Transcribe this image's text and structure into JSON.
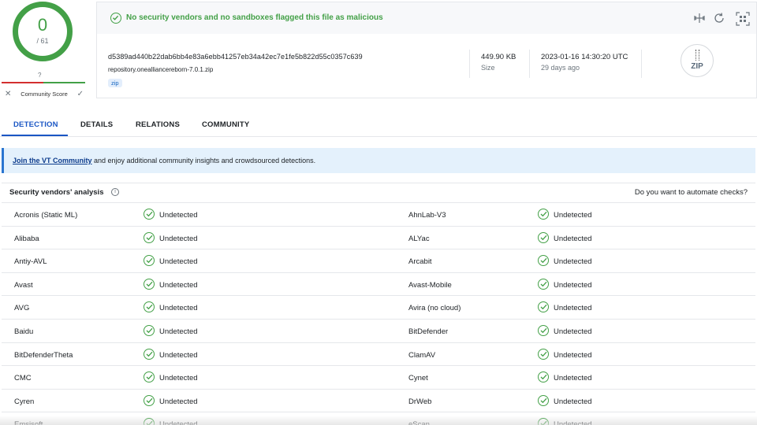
{
  "score": {
    "detections": "0",
    "total": "/ 61",
    "community_unknown": "?",
    "community_label": "Community Score"
  },
  "verdict": {
    "text": "No security vendors and no sandboxes flagged this file as malicious"
  },
  "toolbar": {
    "icons": [
      "compare-icon",
      "reanalyze-icon",
      "similar-icon"
    ]
  },
  "file": {
    "hash": "d5389ad440b22dab6bb4e83a6ebb41257eb34a42ec7e1fe5b822d55c0357c639",
    "name": "repository.onealliancereborn-7.0.1.zip",
    "tag": "zip",
    "size": "449.90 KB",
    "size_label": "Size",
    "date": "2023-01-16 14:30:20 UTC",
    "date_ago": "29 days ago",
    "type_label": "ZIP"
  },
  "tabs": [
    {
      "label": "DETECTION",
      "active": true
    },
    {
      "label": "DETAILS"
    },
    {
      "label": "RELATIONS"
    },
    {
      "label": "COMMUNITY"
    }
  ],
  "banner": {
    "link": "Join the VT Community",
    "text": " and enjoy additional community insights and crowdsourced detections."
  },
  "vendors": {
    "title": "Security vendors' analysis",
    "automate": "Do you want to automate checks?",
    "rows": [
      {
        "left": "Acronis (Static ML)",
        "left_status": "Undetected",
        "right": "AhnLab-V3",
        "right_status": "Undetected"
      },
      {
        "left": "Alibaba",
        "left_status": "Undetected",
        "right": "ALYac",
        "right_status": "Undetected"
      },
      {
        "left": "Antiy-AVL",
        "left_status": "Undetected",
        "right": "Arcabit",
        "right_status": "Undetected"
      },
      {
        "left": "Avast",
        "left_status": "Undetected",
        "right": "Avast-Mobile",
        "right_status": "Undetected"
      },
      {
        "left": "AVG",
        "left_status": "Undetected",
        "right": "Avira (no cloud)",
        "right_status": "Undetected"
      },
      {
        "left": "Baidu",
        "left_status": "Undetected",
        "right": "BitDefender",
        "right_status": "Undetected"
      },
      {
        "left": "BitDefenderTheta",
        "left_status": "Undetected",
        "right": "ClamAV",
        "right_status": "Undetected"
      },
      {
        "left": "CMC",
        "left_status": "Undetected",
        "right": "Cynet",
        "right_status": "Undetected"
      },
      {
        "left": "Cyren",
        "left_status": "Undetected",
        "right": "DrWeb",
        "right_status": "Undetected"
      },
      {
        "left": "Emsisoft",
        "left_status": "Undetected",
        "right": "eScan",
        "right_status": "Undetected"
      }
    ]
  },
  "colors": {
    "clean": "#43a047",
    "accent": "#1a56c4",
    "banner_bg": "#e4f1fc"
  }
}
